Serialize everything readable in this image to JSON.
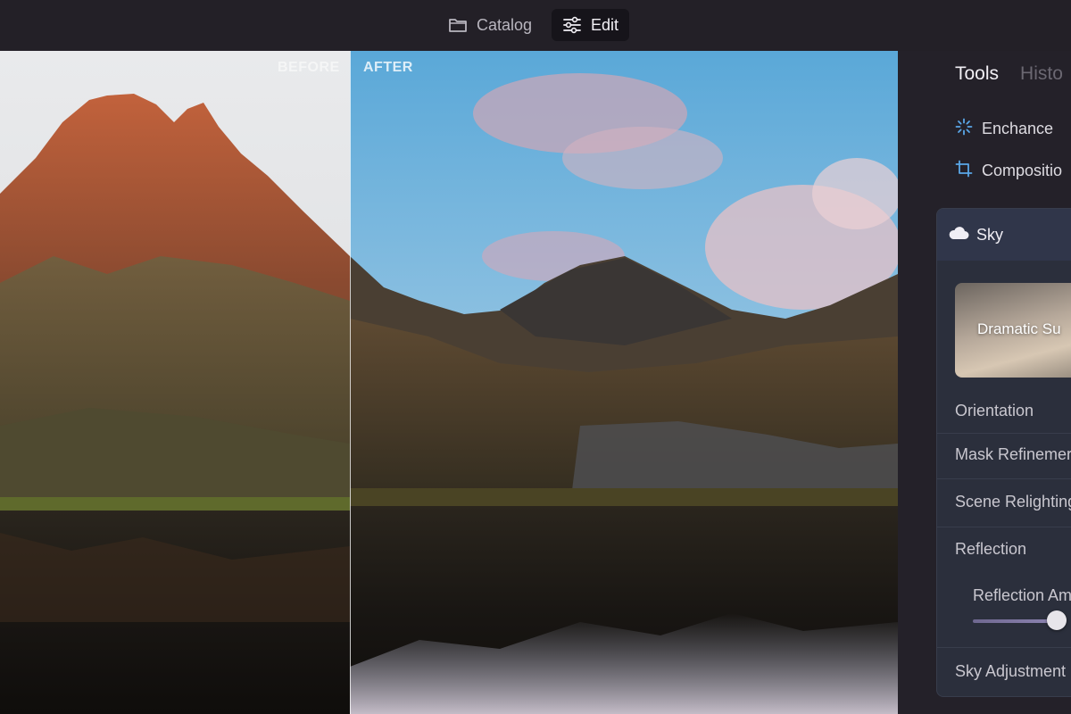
{
  "topbar": {
    "catalog_label": "Catalog",
    "edit_label": "Edit"
  },
  "photo": {
    "before_label": "BEFORE",
    "after_label": "AFTER"
  },
  "panel": {
    "tabs": [
      {
        "label": "Tools",
        "active": true
      },
      {
        "label": "Histo",
        "active": false
      }
    ],
    "tools": [
      {
        "label": "Enchance",
        "icon": "sparkle-icon",
        "color": "#5aa7e8"
      },
      {
        "label": "Compositio",
        "icon": "crop-icon",
        "color": "#5aa7e8"
      }
    ],
    "sky": {
      "title": "Sky",
      "icon": "cloud-icon",
      "preset_label": "Dramatic Su",
      "options": [
        "Orientation",
        "Mask Refinemer",
        "Scene Relighting",
        "Reflection"
      ],
      "reflection_amount_label": "Reflection Am",
      "reflection_amount_value": 0.85,
      "sky_adjustments_label": "Sky Adjustment"
    }
  }
}
